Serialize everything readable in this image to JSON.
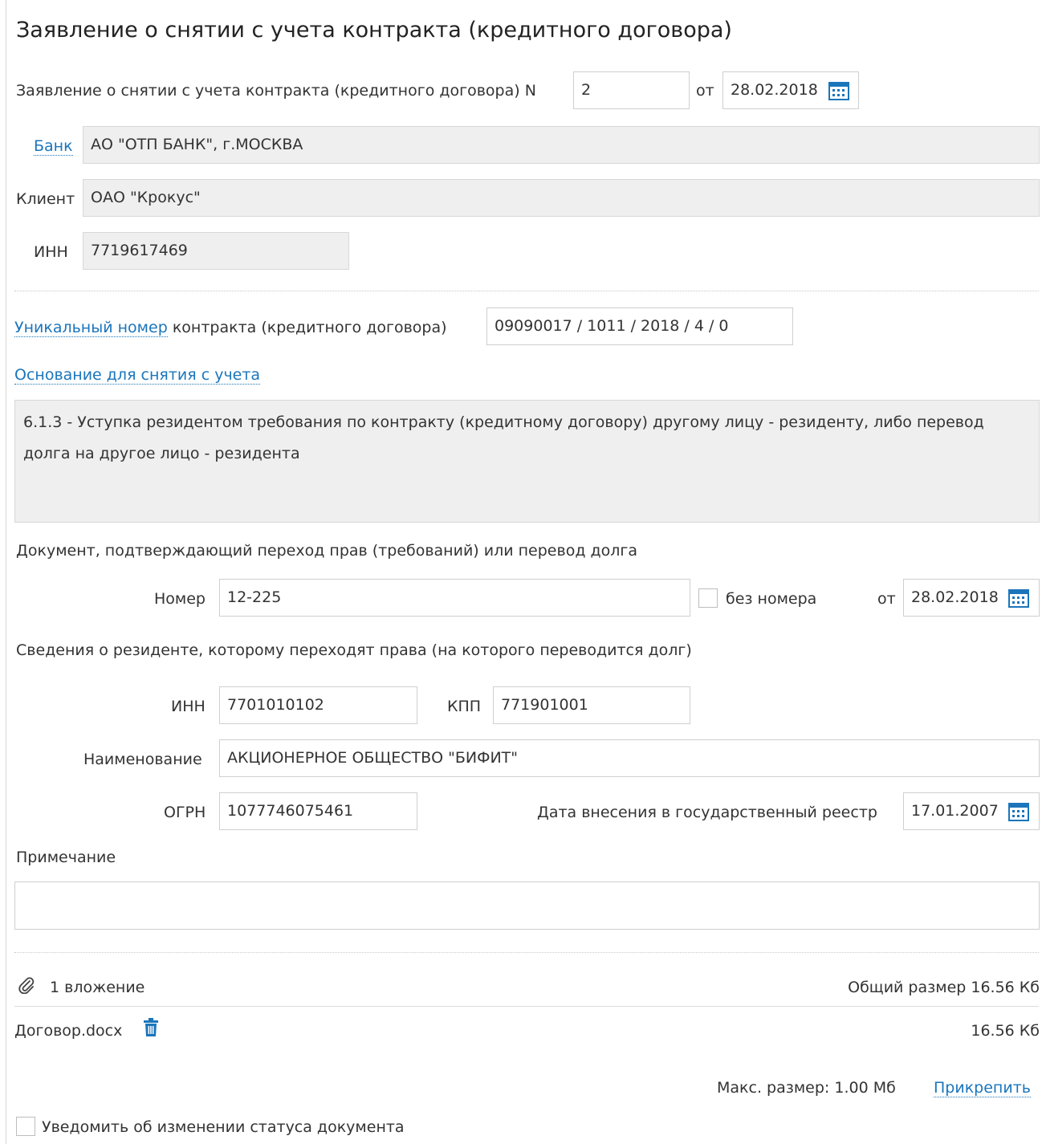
{
  "page_title": "Заявление о снятии с учета контракта (кредитного договора)",
  "statement": {
    "label": "Заявление о снятии с учета контракта (кредитного договора) N",
    "number": "2",
    "from_label": "от",
    "date": "28.02.2018"
  },
  "bank": {
    "label": "Банк",
    "value": "АО \"ОТП БАНК\", г.МОСКВА"
  },
  "client": {
    "label": "Клиент",
    "value": "ОАО \"Крокус\""
  },
  "inn": {
    "label": "ИНН",
    "value": "7719617469"
  },
  "unique_number": {
    "link_label": "Уникальный номер",
    "label": "контракта (кредитного договора)",
    "value": "09090017 / 1011 / 2018 / 4 / 0"
  },
  "basis": {
    "link_label": "Основание для снятия с учета",
    "text": "6.1.3 - Уступка резидентом требования по контракту (кредитному договору) другому лицу - резиденту, либо перевод долга на другое лицо - резидента"
  },
  "transfer_doc": {
    "heading": "Документ, подтверждающий переход прав (требований) или перевод долга",
    "number_label": "Номер",
    "number": "12-225",
    "no_number_label": "без номера",
    "no_number_checked": false,
    "from_label": "от",
    "date": "28.02.2018"
  },
  "resident": {
    "heading": "Сведения о резиденте, которому переходят права (на которого переводится долг)",
    "inn_label": "ИНН",
    "inn": "7701010102",
    "kpp_label": "КПП",
    "kpp": "771901001",
    "name_label": "Наименование",
    "name": "АКЦИОНЕРНОЕ ОБЩЕСТВО \"БИФИТ\"",
    "ogrn_label": "ОГРН",
    "ogrn": "1077746075461",
    "reg_date_label": "Дата внесения в государственный реестр",
    "reg_date": "17.01.2007"
  },
  "note": {
    "label": "Примечание",
    "value": ""
  },
  "attachments": {
    "count_label": "1 вложение",
    "total_size_label": "Общий размер 16.56 Кб",
    "files": [
      {
        "name": "Договор.docx",
        "size": "16.56 Кб"
      }
    ],
    "max_size_label": "Макс. размер: 1.00 Мб",
    "attach_label": "Прикрепить"
  },
  "notify": {
    "label": "Уведомить об изменении статуса документа",
    "checked": false
  },
  "colors": {
    "link": "#1b75bb",
    "readonly_bg": "#efefef",
    "border": "#cfcfcf"
  }
}
